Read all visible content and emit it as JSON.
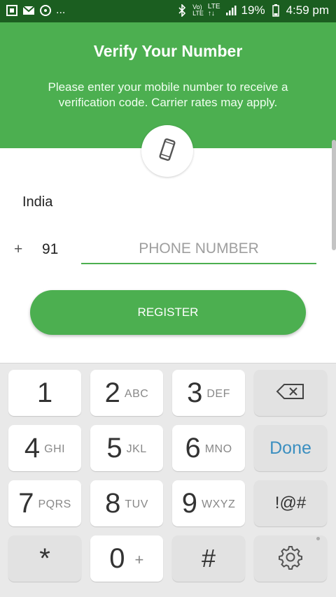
{
  "status_bar": {
    "battery": "19%",
    "time": "4:59 pm",
    "more": "..."
  },
  "header": {
    "title": "Verify Your Number",
    "subtitle": "Please enter your mobile number to receive a verification code. Carrier rates may apply."
  },
  "form": {
    "country": "India",
    "plus": "+",
    "country_code": "91",
    "phone_placeholder": "PHONE NUMBER",
    "register_label": "REGISTER"
  },
  "keyboard": {
    "keys": [
      {
        "main": "1",
        "sub": ""
      },
      {
        "main": "2",
        "sub": "ABC"
      },
      {
        "main": "3",
        "sub": "DEF"
      },
      {
        "main": "4",
        "sub": "GHI"
      },
      {
        "main": "5",
        "sub": "JKL"
      },
      {
        "main": "6",
        "sub": "MNO"
      },
      {
        "main": "7",
        "sub": "PQRS"
      },
      {
        "main": "8",
        "sub": "TUV"
      },
      {
        "main": "9",
        "sub": "WXYZ"
      },
      {
        "main": "*",
        "sub": ""
      },
      {
        "main": "0",
        "sub": "+"
      },
      {
        "main": "#",
        "sub": ""
      }
    ],
    "done_label": "Done",
    "symbols_label": "!@#"
  },
  "colors": {
    "accent": "#4caf50",
    "status_bar": "#1b5e20",
    "done": "#3b8fc0"
  },
  "icons": [
    "phone-icon",
    "backspace-icon",
    "settings-icon",
    "bluetooth-icon",
    "signal-icon",
    "battery-icon"
  ]
}
